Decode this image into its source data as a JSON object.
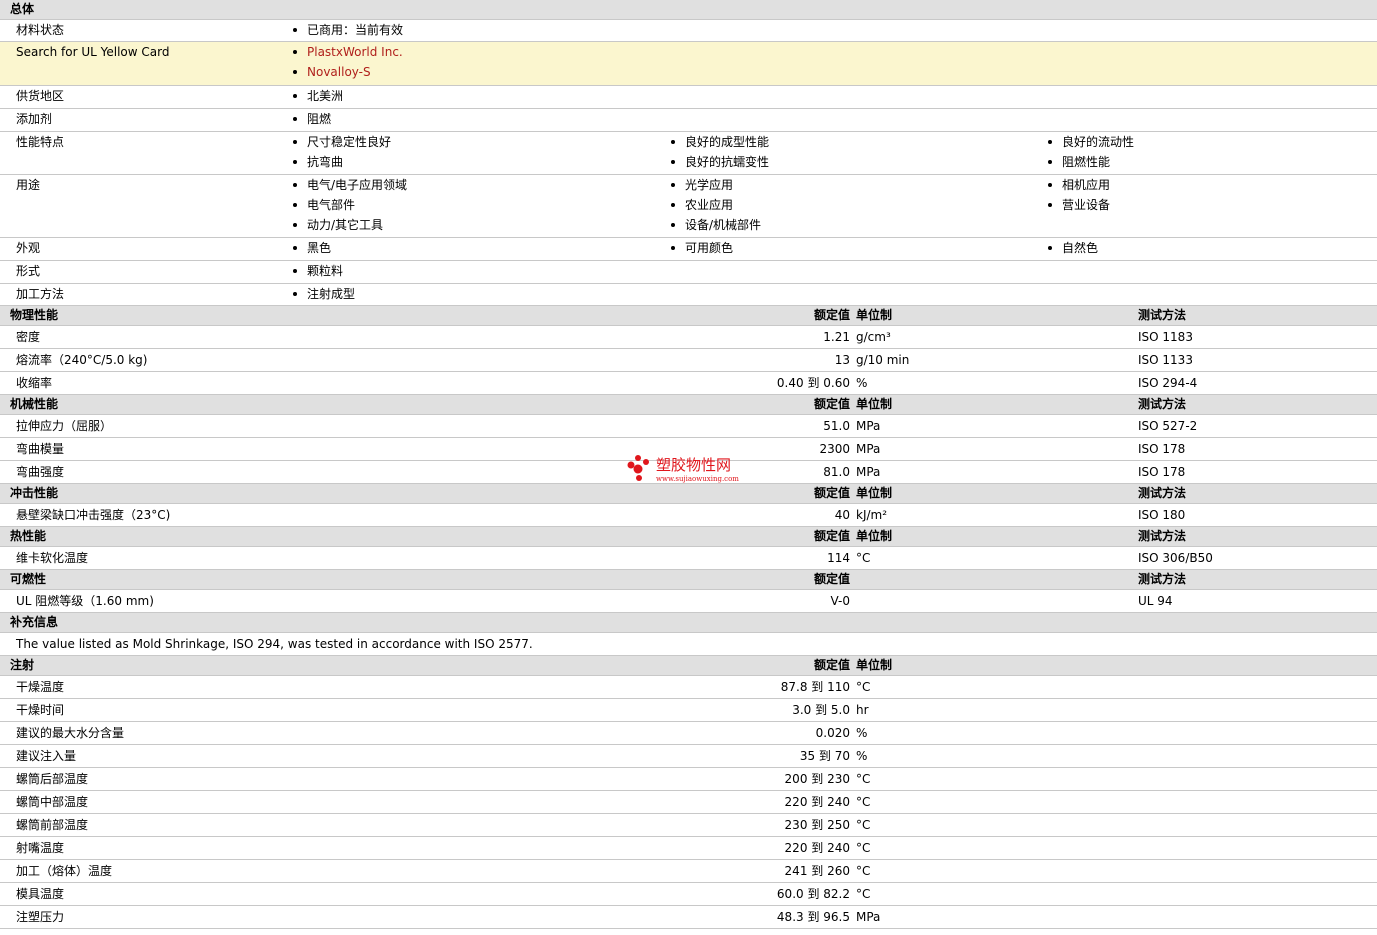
{
  "general": {
    "header": "总体",
    "rows": [
      {
        "label": "材料状态",
        "items": [
          "已商用：当前有效"
        ]
      },
      {
        "label": "Search for UL Yellow Card",
        "items": [
          "PlastxWorld Inc.",
          "Novalloy-S"
        ],
        "links": true
      },
      {
        "label": "供货地区",
        "items": [
          "北美洲"
        ]
      },
      {
        "label": "添加剂",
        "items": [
          "阻燃"
        ]
      },
      {
        "label": "性能特点",
        "items": [
          "尺寸稳定性良好",
          "良好的成型性能",
          "良好的流动性",
          "抗弯曲",
          "良好的抗蠕变性",
          "阻燃性能"
        ]
      },
      {
        "label": "用途",
        "items": [
          "电气/电子应用领域",
          "光学应用",
          "相机应用",
          "电气部件",
          "农业应用",
          "营业设备",
          "动力/其它工具",
          "设备/机械部件"
        ]
      },
      {
        "label": "外观",
        "items": [
          "黑色",
          "可用颜色",
          "自然色"
        ]
      },
      {
        "label": "形式",
        "items": [
          "颗粒料"
        ]
      },
      {
        "label": "加工方法",
        "items": [
          "注射成型"
        ]
      }
    ]
  },
  "col_headers": {
    "nominal": "额定值",
    "unit": "单位制",
    "method": "测试方法"
  },
  "physical": {
    "header": "物理性能",
    "rows": [
      {
        "label": "密度",
        "value": "1.21",
        "unit": "g/cm³",
        "method": "ISO 1183"
      },
      {
        "label": "熔流率（240°C/5.0 kg)",
        "value": "13",
        "unit": "g/10 min",
        "method": "ISO 1133"
      },
      {
        "label": "收缩率",
        "value": "0.40 到 0.60",
        "unit": "%",
        "method": "ISO 294-4"
      }
    ]
  },
  "mechanical": {
    "header": "机械性能",
    "rows": [
      {
        "label": "拉伸应力（屈服）",
        "value": "51.0",
        "unit": "MPa",
        "method": "ISO 527-2"
      },
      {
        "label": "弯曲模量",
        "value": "2300",
        "unit": "MPa",
        "method": "ISO 178"
      },
      {
        "label": "弯曲强度",
        "value": "81.0",
        "unit": "MPa",
        "method": "ISO 178"
      }
    ]
  },
  "impact": {
    "header": "冲击性能",
    "rows": [
      {
        "label": "悬壁梁缺口冲击强度（23°C)",
        "value": "40",
        "unit": "kJ/m²",
        "method": "ISO 180"
      }
    ]
  },
  "thermal": {
    "header": "热性能",
    "rows": [
      {
        "label": "维卡软化温度",
        "value": "114",
        "unit": "°C",
        "method": "ISO 306/B50"
      }
    ]
  },
  "flammability": {
    "header": "可燃性",
    "rows": [
      {
        "label": "UL 阻燃等级（1.60 mm)",
        "value": "V-0",
        "unit": "",
        "method": "UL 94"
      }
    ]
  },
  "supplemental": {
    "header": "补充信息",
    "text": "The value listed as Mold Shrinkage, ISO 294, was tested in accordance with ISO 2577."
  },
  "injection": {
    "header": "注射",
    "rows": [
      {
        "label": "干燥温度",
        "value": "87.8 到 110",
        "unit": "°C"
      },
      {
        "label": "干燥时间",
        "value": "3.0 到 5.0",
        "unit": "hr"
      },
      {
        "label": "建议的最大水分含量",
        "value": "0.020",
        "unit": "%"
      },
      {
        "label": "建议注入量",
        "value": "35 到 70",
        "unit": "%"
      },
      {
        "label": "螺筒后部温度",
        "value": "200 到 230",
        "unit": "°C"
      },
      {
        "label": "螺筒中部温度",
        "value": "220 到 240",
        "unit": "°C"
      },
      {
        "label": "螺筒前部温度",
        "value": "230 到 250",
        "unit": "°C"
      },
      {
        "label": "射嘴温度",
        "value": "220 到 240",
        "unit": "°C"
      },
      {
        "label": "加工（熔体）温度",
        "value": "241 到 260",
        "unit": "°C"
      },
      {
        "label": "模具温度",
        "value": "60.0 到 82.2",
        "unit": "°C"
      },
      {
        "label": "注塑压力",
        "value": "48.3 到 96.5",
        "unit": "MPa"
      }
    ]
  },
  "watermark": {
    "name": "塑胶物性网",
    "url": "www.sujiaowuxing.com"
  },
  "colors": {
    "header_bg": "#e0e0e0",
    "yellow_bg": "#fbf6cf",
    "link": "#b0201c",
    "watermark_red": "#e0161c"
  }
}
